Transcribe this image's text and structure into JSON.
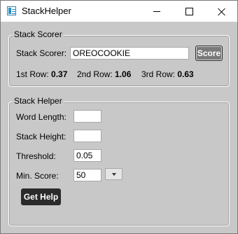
{
  "window": {
    "title": "StackHelper"
  },
  "scorer": {
    "group_title": "Stack Scorer",
    "field_label": "Stack Scorer:",
    "field_value": "OREOCOOKIE",
    "score_button": "Score",
    "rows": [
      {
        "label": "1st Row:",
        "value": "0.37"
      },
      {
        "label": "2nd Row:",
        "value": "1.06"
      },
      {
        "label": "3rd Row:",
        "value": "0.63"
      }
    ]
  },
  "helper": {
    "group_title": "Stack Helper",
    "word_length_label": "Word Length:",
    "word_length_value": "",
    "stack_height_label": "Stack Height:",
    "stack_height_value": "",
    "threshold_label": "Threshold:",
    "threshold_value": "0.05",
    "min_score_label": "Min. Score:",
    "min_score_value": "50",
    "get_help_button": "Get Help"
  }
}
